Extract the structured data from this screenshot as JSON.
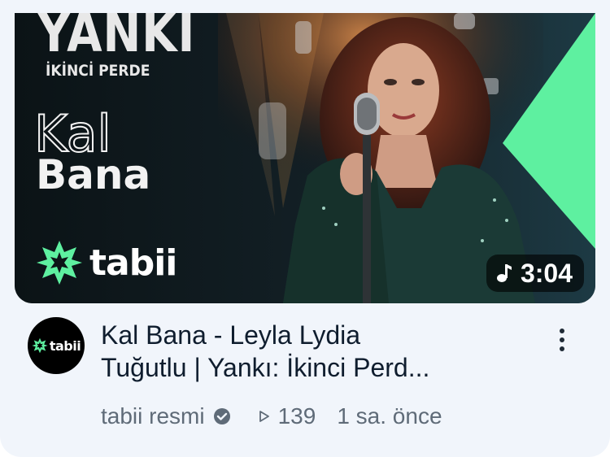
{
  "thumbnail": {
    "series_title": "YANKI",
    "series_subtitle": "İKİNCİ PERDE",
    "song_line1": "Kal",
    "song_line2": "Bana",
    "brand": "tabii",
    "duration": "3:04",
    "duration_icon": "music-note-icon",
    "accent_color": "#5ef0a0"
  },
  "channel": {
    "avatar_text": "tabii",
    "name": "tabii resmi",
    "verified_icon": "verified-check-icon"
  },
  "video": {
    "title_line1": "Kal Bana - Leyla Lydia",
    "title_line2": "Tuğutlu | Yankı: İkinci Perd...",
    "views": "139",
    "time_ago": "1 sa. önce",
    "views_icon": "play-outline-icon",
    "more_icon": "more-vertical-icon"
  }
}
